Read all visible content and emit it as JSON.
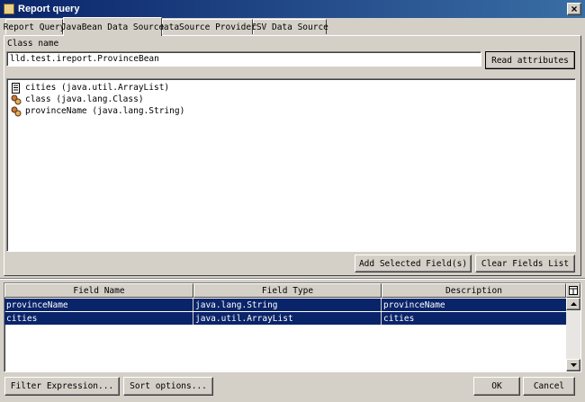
{
  "window": {
    "title": "Report query",
    "close_glyph": "×"
  },
  "tabs": [
    {
      "label": "Report Query"
    },
    {
      "label": "JavaBean Data Source"
    },
    {
      "label": "DataSource Provider"
    },
    {
      "label": "CSV Data Source"
    }
  ],
  "javabean": {
    "class_label": "Class name",
    "class_value": "lld.test.ireport.ProvinceBean",
    "read_button": "Read attributes",
    "attributes": [
      {
        "text": "cities (java.util.ArrayList)",
        "icon": "list-attribute-icon"
      },
      {
        "text": "class (java.lang.Class)",
        "icon": "bean-attribute-icon"
      },
      {
        "text": "provinceName (java.lang.String)",
        "icon": "bean-attribute-icon"
      }
    ],
    "add_button": "Add Selected Field(s)",
    "clear_button": "Clear Fields List"
  },
  "fields_table": {
    "columns": [
      "Field Name",
      "Field Type",
      "Description"
    ],
    "rows": [
      {
        "name": "provinceName",
        "type": "java.lang.String",
        "description": "provinceName"
      },
      {
        "name": "cities",
        "type": "java.util.ArrayList",
        "description": "cities"
      }
    ],
    "selection_color": "#0a246a",
    "corner_icon": "column-chooser-icon"
  },
  "bottom": {
    "filter_button": "Filter Expression...",
    "sort_button": "Sort options...",
    "ok_button": "OK",
    "cancel_button": "Cancel"
  }
}
